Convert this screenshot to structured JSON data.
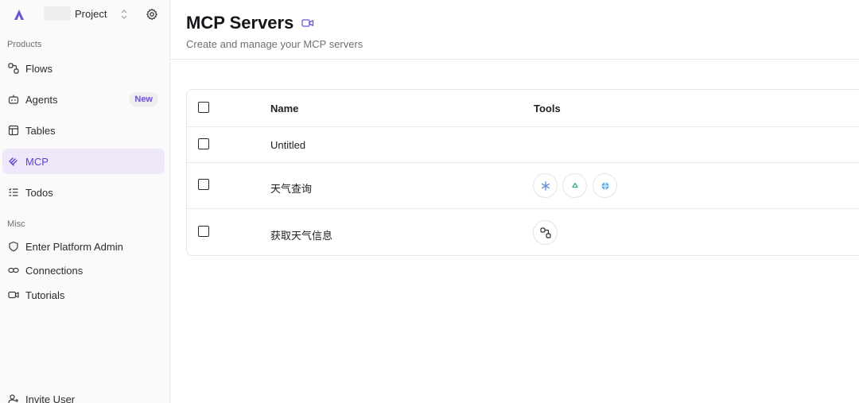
{
  "sidebar": {
    "project_name": "Project",
    "sections": {
      "products": "Products",
      "misc": "Misc"
    },
    "items": [
      {
        "label": "Flows",
        "icon": "flows-icon"
      },
      {
        "label": "Agents",
        "icon": "agents-icon",
        "badge": "New"
      },
      {
        "label": "Tables",
        "icon": "table-icon"
      },
      {
        "label": "MCP",
        "icon": "mcp-icon",
        "active": true
      },
      {
        "label": "Todos",
        "icon": "todos-icon"
      }
    ],
    "misc_items": [
      {
        "label": "Enter Platform Admin",
        "icon": "shield-icon"
      },
      {
        "label": "Connections",
        "icon": "link-icon"
      },
      {
        "label": "Tutorials",
        "icon": "video-icon"
      }
    ],
    "footer_label": "Invite User"
  },
  "header": {
    "title": "MCP Servers",
    "subtitle": "Create and manage your MCP servers"
  },
  "table": {
    "columns": {
      "name": "Name",
      "tools": "Tools"
    },
    "rows": [
      {
        "name": "Untitled",
        "tools": []
      },
      {
        "name": "天气查询",
        "tools": [
          "asterisk-tool-icon",
          "recycle-tool-icon",
          "globe-tool-icon"
        ]
      },
      {
        "name": "获取天气信息",
        "tools": [
          "flow-tool-icon"
        ]
      }
    ]
  },
  "colors": {
    "accent": "#6d52d6",
    "active_bg": "#efe8fb",
    "sidebar_bg": "#fafafa",
    "border": "#e4e4e8"
  }
}
